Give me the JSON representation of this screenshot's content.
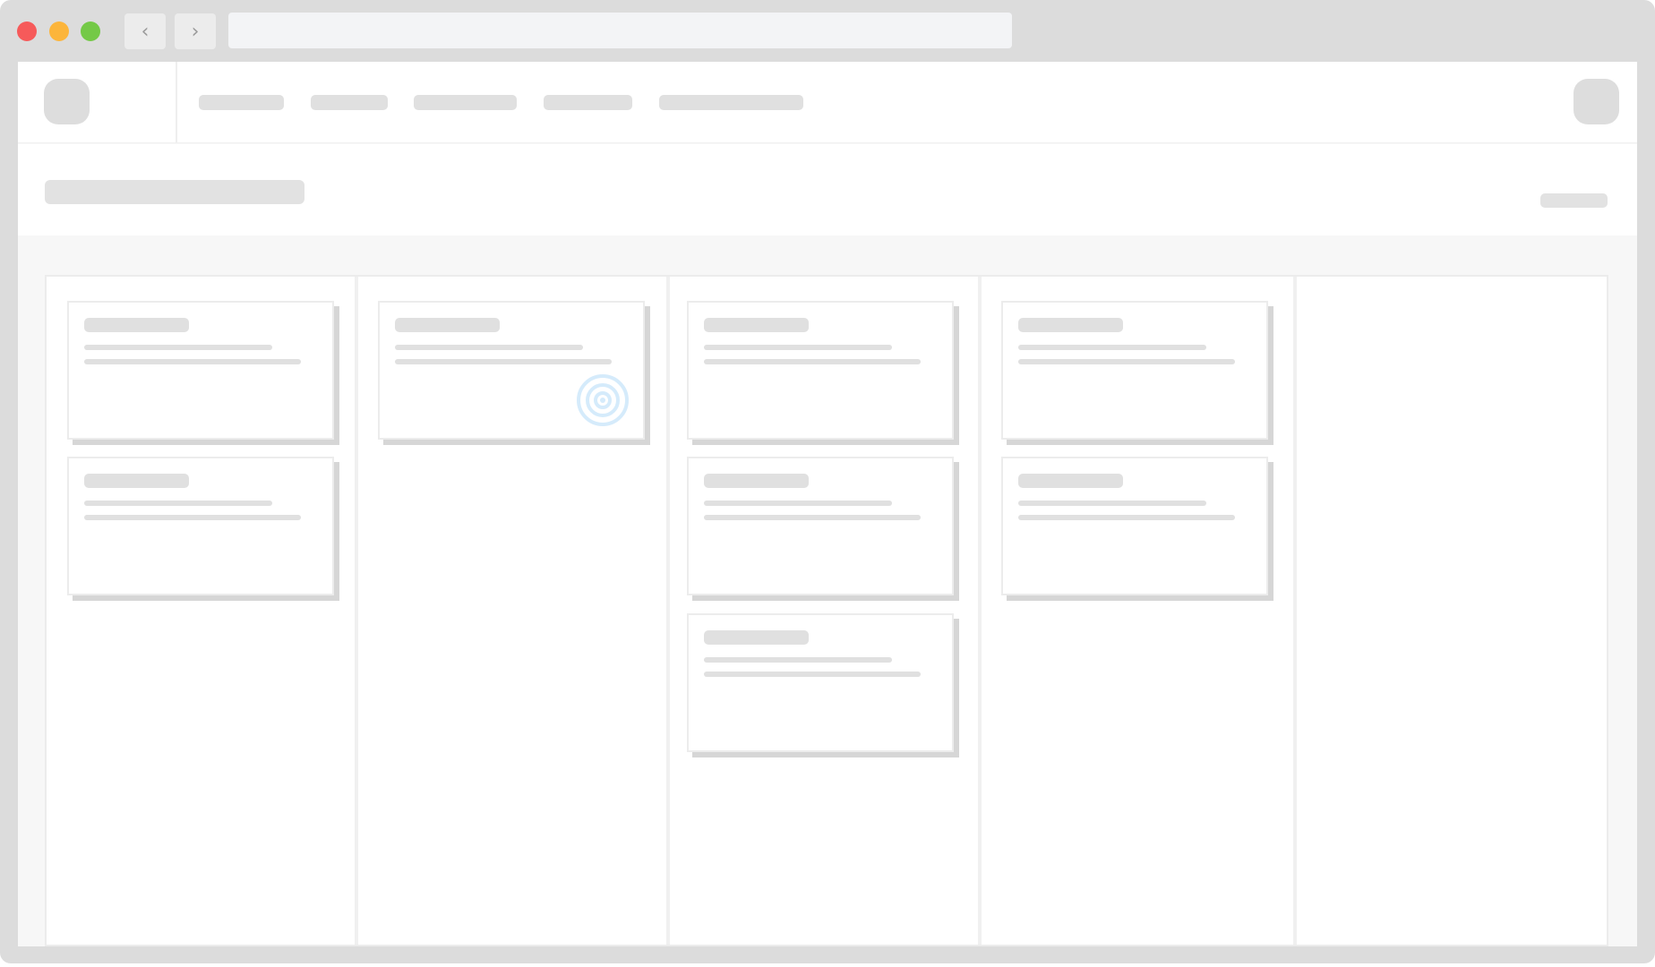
{
  "colors": {
    "close_dot": "#f65a5a",
    "minimize_dot": "#fcb53b",
    "zoom_dot": "#74c947",
    "placeholder": "#e0e0e0",
    "target": "#d5ebfb"
  },
  "browser": {
    "back_icon": "chevron-left-icon",
    "forward_icon": "chevron-right-icon",
    "url": ""
  },
  "header": {
    "menu_items": 5
  },
  "board": {
    "columns": [
      {
        "cards": 2
      },
      {
        "cards": 1,
        "target_card": 0
      },
      {
        "cards": 3
      },
      {
        "cards": 2
      },
      {
        "cards": 0
      }
    ]
  }
}
